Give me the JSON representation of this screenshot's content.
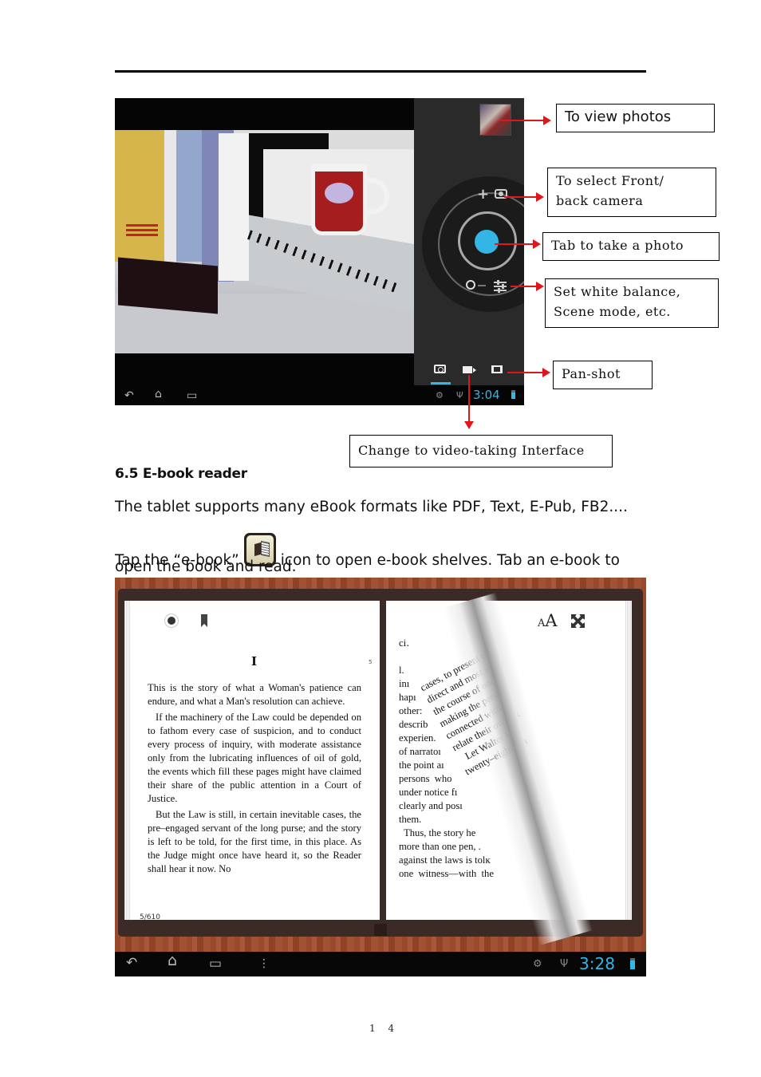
{
  "page": {
    "section_title": "6.5 E-book reader",
    "paragraph_1": "The tablet supports many eBook formats like PDF, Text, E-Pub, FB2....",
    "paragraph_2_before_icon": "Tap the “e-book”",
    "paragraph_2_after_icon": "icon to open e-book shelves. Tab an e-book to",
    "paragraph_2_line2": "open the book and read.",
    "inline_icon": "ebook-app-icon",
    "footer_page_number": "1 4"
  },
  "camera_screenshot": {
    "status_time": "3:04",
    "accent_color": "#33b5e5",
    "dial": {
      "plus": "+",
      "minus": "−"
    },
    "modes": [
      "photo",
      "video",
      "panorama"
    ],
    "active_mode": "photo",
    "nav_icons": [
      "back-icon",
      "home-icon",
      "recent-apps-icon"
    ],
    "status_icons": [
      "android-debug-icon",
      "usb-icon",
      "battery-icon"
    ]
  },
  "callouts": {
    "view_photos": "To view photos",
    "front_back_camera_line1": "To select Front/",
    "front_back_camera_line2": "back camera",
    "take_photo": "Tab to take a photo",
    "settings_line1": "Set white balance,",
    "settings_line2": "Scene mode, etc.",
    "pan_shot": "Pan-shot",
    "video_interface": "Change to video-taking Interface",
    "arrow_color": "#e0161a"
  },
  "ebook_screenshot": {
    "status_time": "3:28",
    "chapter": "I",
    "page_marker": "5",
    "page_counter": "5/610",
    "font_size_icon": {
      "small": "A",
      "big": "A"
    },
    "left_page_paragraphs": [
      "This is the story of what a Woman's patience can endure, and what a Man's resolution can achieve.",
      "If the machinery of the Law could be depended on to fathom every case of suspicion, and to conduct every process of inquiry, with moderate assistance only from the lubricating influences of oil of gold, the events which fill these pages might have claimed their share of the public attention in a Court of Justice.",
      "But the Law is still, in certain inevitable cases, the pre–engaged servant of the long purse; and the story is left to be told, for the first time, in this place. As the Judge might once have heard it, so the Reader shall hear it now. No"
    ],
    "right_page_lines": [
      "ci․",
      "",
      "l.",
      "inı",
      "hapı",
      "other:",
      "describ",
      "experien.",
      "of narratoı",
      "the point aı",
      "persons  who",
      "under notice fı",
      "clearly and posı",
      "them.",
      "  Thus, the story he",
      "more than one pen, .",
      "against the laws is tolĸ",
      "one  witness—with  the"
    ],
    "curl_lines": [
      "cases, to present the",
      "direct and most intell",
      "the course of one co",
      "making the persons",
      "connected with the",
      "relate their own ex",
      "   Let Walter Hart",
      "twenty–eight yea"
    ],
    "nav_icons": [
      "back-icon",
      "home-icon",
      "recent-apps-icon",
      "menu-icon"
    ]
  }
}
